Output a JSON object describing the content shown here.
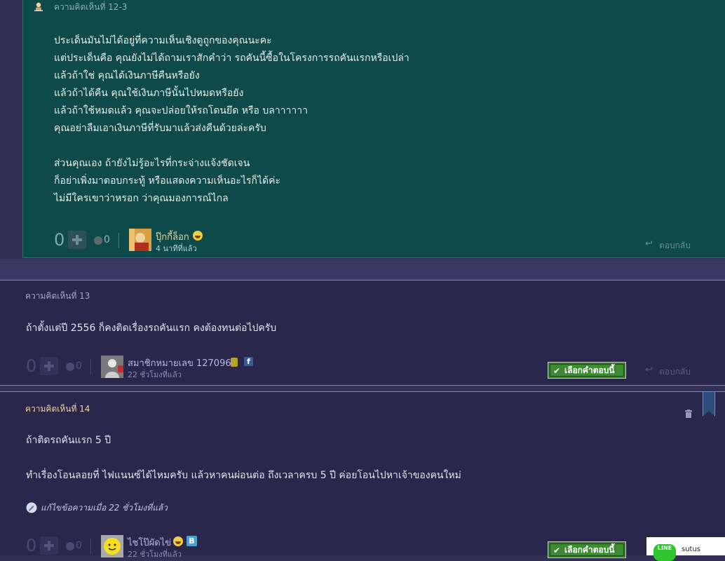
{
  "reply_12_3": {
    "label": "ความคิดเห็นที่ 12-3",
    "lines": [
      "ประเด็นมันไม่ได้อยู่ที่ความเห็นเชิงดูถูกของคุณนะคะ",
      "แต่ประเด็นคือ คุณยังไม่ได้ถามเราสักคำว่า รถคันนี้ซื้อในโครงการรถคันแรกหรือเปล่า",
      "แล้วถ้าใช่ คุณได้เงินภาษีคืนหรือยัง",
      "แล้วถ้าได้คืน คุณใช้เงินภาษีนั้นไปหมดหรือยัง",
      "แล้วถ้าใช้หมดแล้ว คุณจะปล่อยให้รถโดนยึด หรือ บลาาาาาา",
      "คุณอย่าลืมเอาเงินภาษีที่รับมาแล้วส่งคืนด้วยล่ะครับ",
      "",
      "ส่วนคุณเอง ถ้ายังไม่รู้อะไรที่กระจ่างแจ้งชัดเจน",
      "ก็อย่าเพิ่งมาตอบกระทู้ หรือแสดงความเห็นอะไรก็ได้ค่ะ",
      "ไม่มีใครเขาว่าหรอก ว่าคุณมองการณ์ไกล"
    ],
    "vote_count": "0",
    "emotion_count": "0",
    "user": "ปุ๊กกี้ล็อก",
    "time": "4 นาทีที่แล้ว",
    "reply_label": "ตอบกลับ"
  },
  "comment_13": {
    "label": "ความคิดเห็นที่ 13",
    "text": "ถ้าตั้งแต่ปี 2556 ก็คงติดเรื่องรถคันแรก  คงต้องทนต่อไปครับ",
    "vote_count": "0",
    "emotion_count": "0",
    "user": "สมาชิกหมายเลข 1270962",
    "time": "22 ชั่วโมงที่แล้ว",
    "select_label": "เลือกคำตอบนี้",
    "reply_label": "ตอบกลับ",
    "fb_letter": "f"
  },
  "comment_14": {
    "label": "ความคิดเห็นที่ 14",
    "text1": "ถ้าติดรถคันแรก 5 ปี",
    "text2": "ทำเรื่องโอนลอยที่ ไฟแนนซ์ได้ไหมครับ แล้วหาคนผ่อนต่อ ถึงเวลาครบ 5 ปี ค่อยโอนไปหาเจ้าของคนใหม่",
    "edit_note": "แก้ไขข้อความเมื่อ 22 ชั่วโมงที่แล้ว",
    "vote_count": "0",
    "emotion_count": "0",
    "user": "ไชโป๊ผัดไข่",
    "time": "22 ชั่วโมงที่แล้ว",
    "select_label": "เลือกคำตอบนี้",
    "blog_letter": "B"
  },
  "line_widget": {
    "logo_text": "LINE",
    "text": "sutus"
  },
  "colors": {
    "page_bg": "#332f55",
    "reply_bg": "#0e4a4a",
    "section_bg": "#2a264c",
    "accept_green": "#3d8a33"
  }
}
